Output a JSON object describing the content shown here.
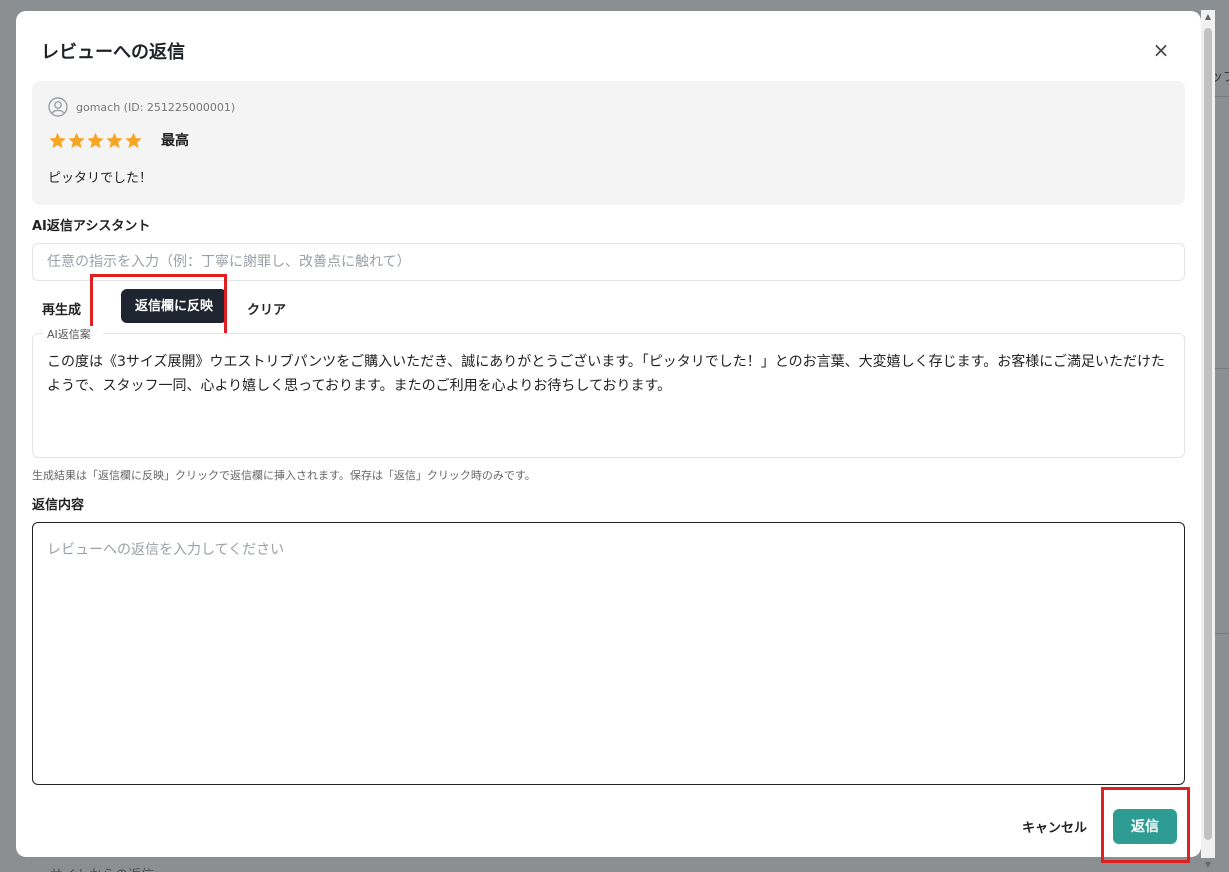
{
  "background": {
    "right_text": "ップ",
    "bottom_text": "サイトからの返信"
  },
  "modal": {
    "title": "レビューへの返信",
    "close_label": "×"
  },
  "review": {
    "user": "gomach (ID: 251225000001)",
    "rating": 5,
    "rating_max": 5,
    "rating_label": "最高",
    "text": "ピッタリでした！"
  },
  "ai_assistant": {
    "label": "AI返信アシスタント",
    "input_value": "",
    "input_placeholder": "任意の指示を入力（例：丁寧に謝罪し、改善点に触れて）",
    "regenerate_label": "再生成",
    "reflect_label": "返信欄に反映",
    "clear_label": "クリア",
    "draft_legend": "AI返信案",
    "draft_text": "この度は《3サイズ展開》ウエストリブパンツをご購入いただき、誠にありがとうございます。「ピッタリでした！」とのお言葉、大変嬉しく存じます。お客様にご満足いただけたようで、スタッフ一同、心より嬉しく思っております。またのご利用を心よりお待ちしております。",
    "helper_text": "生成結果は「返信欄に反映」クリックで返信欄に挿入されます。保存は「返信」クリック時のみです。"
  },
  "reply": {
    "label": "返信内容",
    "value": "",
    "placeholder": "レビューへの返信を入力してください"
  },
  "footer": {
    "cancel_label": "キャンセル",
    "submit_label": "返信"
  },
  "colors": {
    "star": "#f5a623",
    "primary_dark": "#1f2530",
    "submit": "#2f9c93",
    "highlight": "#e02020"
  }
}
